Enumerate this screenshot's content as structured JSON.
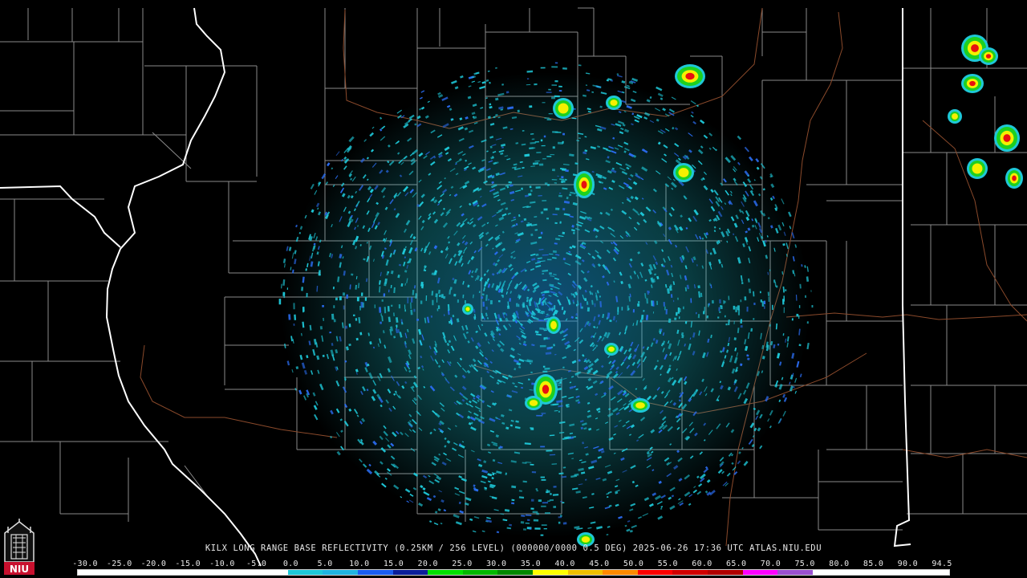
{
  "title": "KILX LONG RANGE BASE REFLECTIVITY (0.25KM / 256 LEVEL) (000000/0000 0.5 DEG) 2025-06-26 17:36 UTC  ATLAS.NIU.EDU",
  "logo_text": "NIU",
  "colors": {
    "background": "#000000",
    "county_lines": "#8a8a8a",
    "state_lines": "#ffffff",
    "rivers": "#8b4a2b",
    "echo_light": "#1ec8d8",
    "echo_blue": "#2a6cf0",
    "echo_green": "#1fd01f",
    "echo_yellow": "#f4f000",
    "echo_red": "#e81010"
  },
  "scale": {
    "labels": [
      "-30.0",
      "-25.0",
      "-20.0",
      "-15.0",
      "-10.0",
      "-5.0",
      "0.0",
      "5.0",
      "10.0",
      "15.0",
      "20.0",
      "25.0",
      "30.0",
      "35.0",
      "40.0",
      "45.0",
      "50.0",
      "55.0",
      "60.0",
      "65.0",
      "70.0",
      "75.0",
      "80.0",
      "85.0",
      "90.0",
      "94.5"
    ],
    "segments": [
      {
        "from": -30,
        "to": 0,
        "color": "#ffffff"
      },
      {
        "from": 0,
        "to": 5,
        "color": "#1ec8d8"
      },
      {
        "from": 5,
        "to": 10,
        "color": "#20b4e0"
      },
      {
        "from": 10,
        "to": 15,
        "color": "#1a5cf0"
      },
      {
        "from": 15,
        "to": 20,
        "color": "#0a1e9a"
      },
      {
        "from": 20,
        "to": 25,
        "color": "#00e000"
      },
      {
        "from": 25,
        "to": 30,
        "color": "#00b800"
      },
      {
        "from": 30,
        "to": 35,
        "color": "#008800"
      },
      {
        "from": 35,
        "to": 40,
        "color": "#ffff00"
      },
      {
        "from": 40,
        "to": 45,
        "color": "#f0c000"
      },
      {
        "from": 45,
        "to": 50,
        "color": "#ff8a00"
      },
      {
        "from": 50,
        "to": 55,
        "color": "#ff0000"
      },
      {
        "from": 55,
        "to": 60,
        "color": "#d00000"
      },
      {
        "from": 60,
        "to": 65,
        "color": "#b00000"
      },
      {
        "from": 65,
        "to": 70,
        "color": "#ff00ff"
      },
      {
        "from": 70,
        "to": 75,
        "color": "#9a50d0"
      },
      {
        "from": 75,
        "to": 94.5,
        "color": "#ffffff"
      }
    ]
  }
}
